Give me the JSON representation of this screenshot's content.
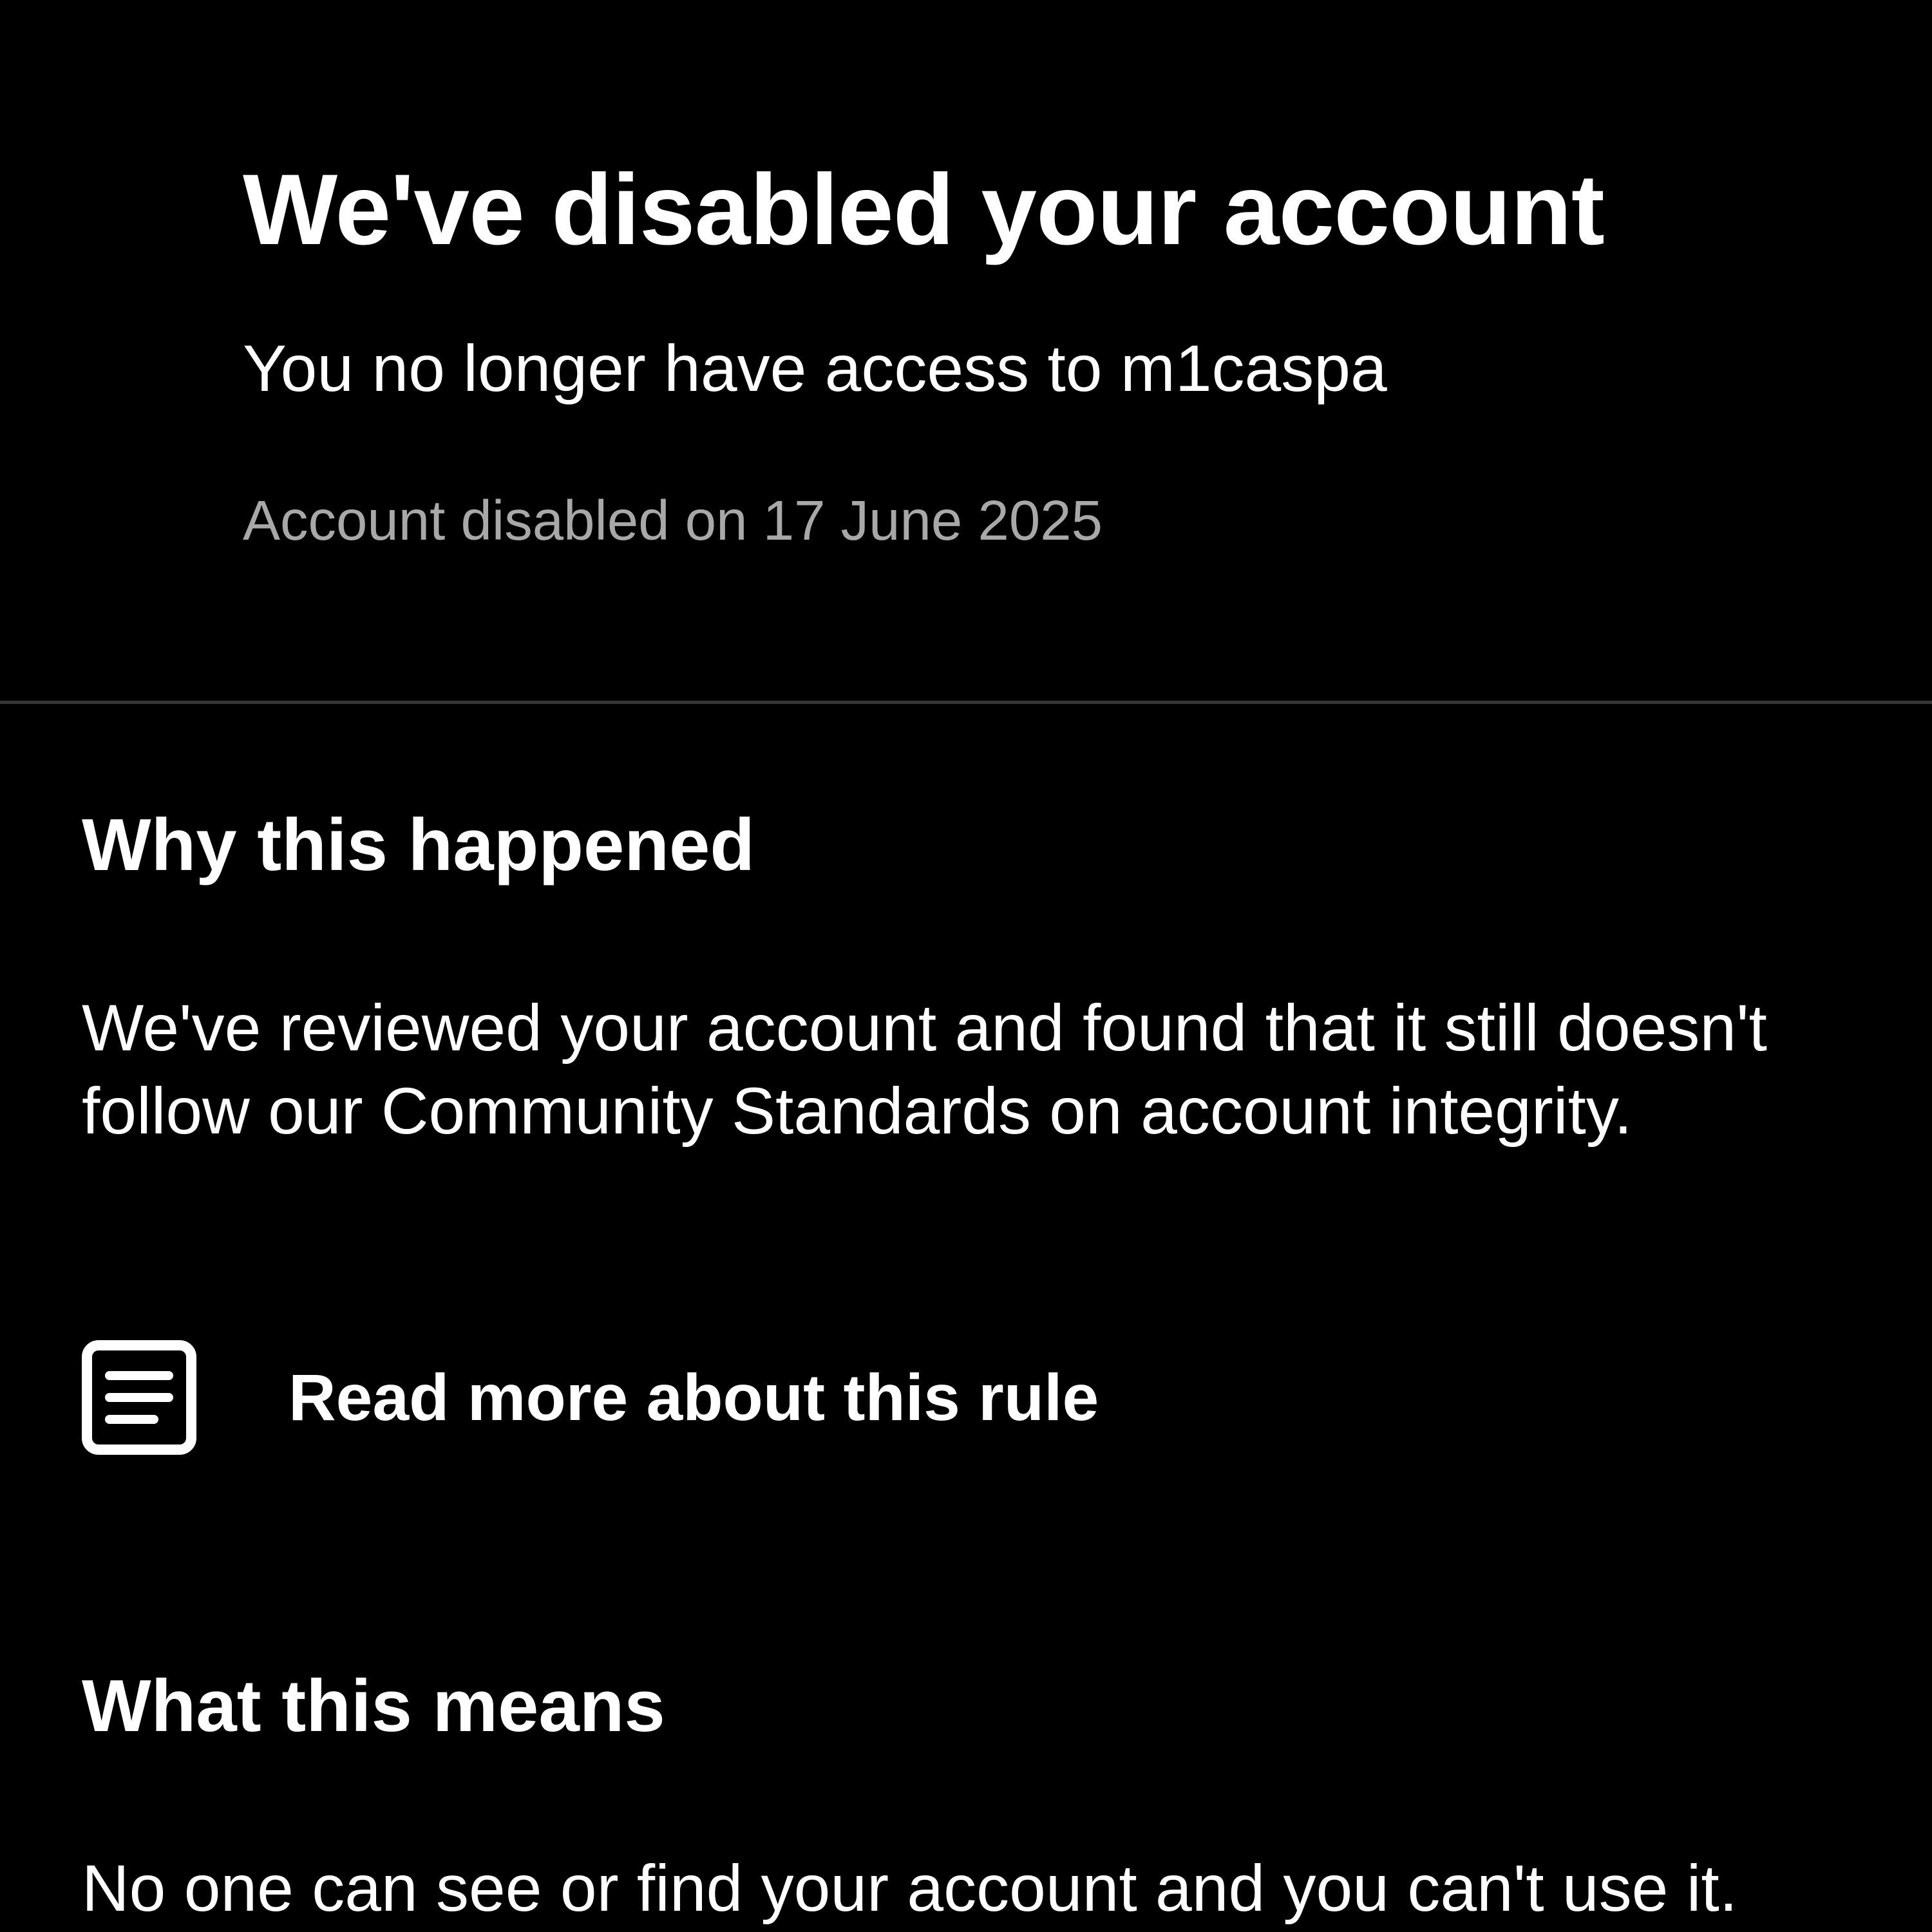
{
  "colors": {
    "background": "#000000",
    "primary_text": "#ffffff",
    "secondary_text": "#a8a8a8",
    "divider": "#363636"
  },
  "header": {
    "title": "We've disabled your account",
    "subtitle": "You no longer have access to m1caspa",
    "disabled_date": "Account disabled on 17 June 2025"
  },
  "why_section": {
    "heading": "Why this happened",
    "body": "We've reviewed your account and found that it still doesn't follow our Community Standards on account integrity.",
    "rule_link": {
      "icon": "document-icon",
      "label": "Read more about this rule"
    }
  },
  "means_section": {
    "heading": "What this means",
    "body": "No one can see or find your account and you can't use it."
  }
}
